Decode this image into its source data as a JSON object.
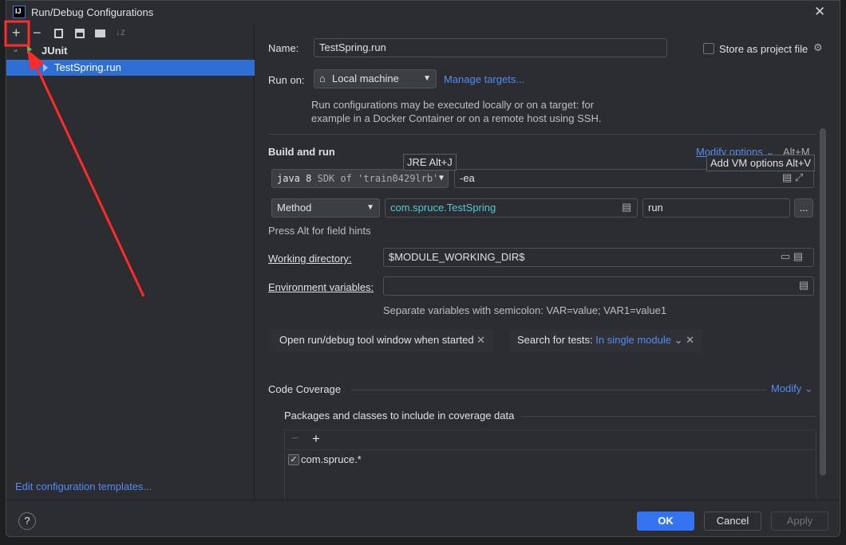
{
  "window": {
    "title": "Run/Debug Configurations",
    "logo": "IJ"
  },
  "toolbar": {
    "add": "+",
    "remove": "−",
    "copy": "copy-icon",
    "save": "save-icon",
    "folder": "new-folder-icon",
    "sort": "sort-icon"
  },
  "tree": {
    "group": "JUnit",
    "item": "TestSpring.run"
  },
  "edit_templates": "Edit configuration templates...",
  "form": {
    "name_label": "Name:",
    "name_value": "TestSpring.run",
    "store_label": "Store as project file",
    "store_checked": false,
    "run_on_label": "Run on:",
    "run_on_value": "Local machine",
    "manage_targets": "Manage targets...",
    "run_on_desc": "Run configurations may be executed locally or on a target: for example in a Docker Container or on a remote host using SSH.",
    "build_run": "Build and run",
    "modify_options": "Modify options",
    "modify_shortcut": "Alt+M",
    "jre_tooltip": "JRE Alt+J",
    "vm_tooltip": "Add VM options Alt+V",
    "jre_value": "java 8",
    "jre_sdk": "SDK of 'train0429lrb'",
    "vm_value": "-ea",
    "test_kind": "Method",
    "class_value": "com.spruce.TestSpring",
    "method_value": "run",
    "more": "...",
    "field_hints": "Press Alt for field hints",
    "workdir_label": "Working directory:",
    "workdir_value": "$MODULE_WORKING_DIR$",
    "env_label": "Environment variables:",
    "env_value": "",
    "env_hint": "Separate variables with semicolon: VAR=value; VAR1=value1",
    "tag_open": "Open run/debug tool window when started",
    "tag_search_label": "Search for tests:",
    "tag_search_value": "In single module",
    "coverage": "Code Coverage",
    "modify": "Modify",
    "packages_label": "Packages and classes to include in coverage data",
    "coverage_items": [
      {
        "label": "com.spruce.*",
        "checked": true
      }
    ]
  },
  "buttons": {
    "ok": "OK",
    "cancel": "Cancel",
    "apply": "Apply",
    "help": "?"
  },
  "colors": {
    "accent": "#3574f0",
    "link": "#548af7",
    "annotation": "#ff2a2a"
  }
}
